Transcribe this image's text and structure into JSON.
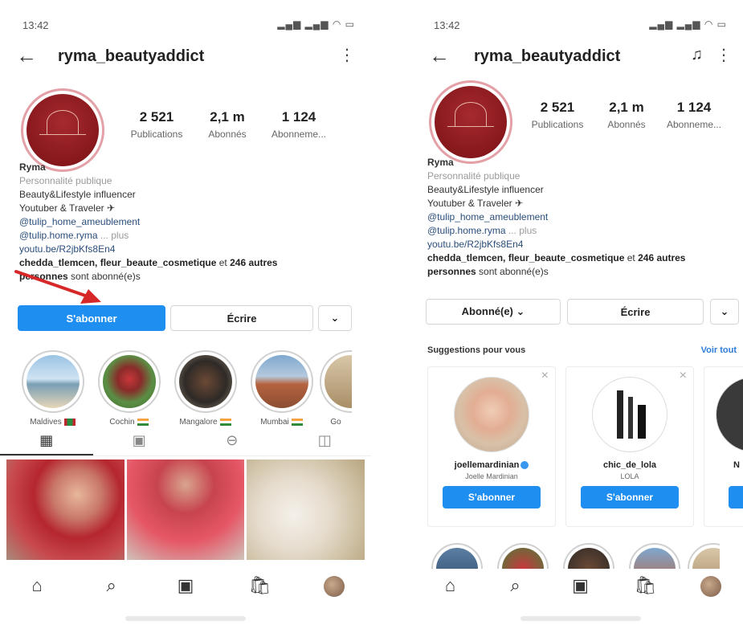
{
  "left": {
    "status_time": "13:42",
    "username": "ryma_beautyaddict",
    "stats": [
      {
        "num": "2 521",
        "label": "Publications"
      },
      {
        "num": "2,1 m",
        "label": "Abonnés"
      },
      {
        "num": "1 124",
        "label": "Abonneme..."
      }
    ],
    "bio": {
      "name": "Ryma",
      "category": "Personnalité publique",
      "line1": "Beauty&Lifestyle influencer",
      "line2": "Youtuber & Traveler",
      "link1": "@tulip_home_ameublement",
      "link2": "@tulip.home.ryma",
      "more": "... plus",
      "url": "youtu.be/R2jbKfs8En4",
      "followed_names": "chedda_tlemcen, fleur_beaute_cosmetique",
      "followed_mid": " et ",
      "followed_count": "246 autres",
      "followed_people": "personnes",
      "followed_end": " sont abonné(e)s"
    },
    "buttons": {
      "follow": "S'abonner",
      "message": "Écrire",
      "dropdown": "⌄"
    },
    "highlights": [
      {
        "label": "Maldives"
      },
      {
        "label": "Cochin"
      },
      {
        "label": "Mangalore"
      },
      {
        "label": "Mumbai"
      },
      {
        "label": "Go"
      }
    ]
  },
  "right": {
    "status_time": "13:42",
    "username": "ryma_beautyaddict",
    "stats": [
      {
        "num": "2 521",
        "label": "Publications"
      },
      {
        "num": "2,1 m",
        "label": "Abonnés"
      },
      {
        "num": "1 124",
        "label": "Abonneme..."
      }
    ],
    "bio": {
      "name": "Ryma",
      "category": "Personnalité publique",
      "line1": "Beauty&Lifestyle influencer",
      "line2": "Youtuber & Traveler",
      "link1": "@tulip_home_ameublement",
      "link2": "@tulip.home.ryma",
      "more": "... plus",
      "url": "youtu.be/R2jbKfs8En4",
      "followed_names": "chedda_tlemcen, fleur_beaute_cosmetique",
      "followed_mid": " et ",
      "followed_count": "246 autres",
      "followed_people": "personnes",
      "followed_end": " sont abonné(e)s"
    },
    "buttons": {
      "following": "Abonné(e) ⌄",
      "message": "Écrire",
      "dropdown": "⌄"
    },
    "suggestions_title": "Suggestions pour vous",
    "see_all": "Voir tout",
    "suggestions": [
      {
        "username": "joellemardinian",
        "name": "Joelle Mardinian",
        "button": "S'abonner"
      },
      {
        "username": "chic_de_lola",
        "name": "LOLA",
        "button": "S'abonner"
      },
      {
        "username": "N",
        "name": "",
        "button": ""
      }
    ]
  },
  "icons": {
    "back": "←",
    "more": "⋮",
    "bell": "🔔",
    "home": "⌂",
    "search": "⌕",
    "reels": "▣",
    "shop": "🛍",
    "close": "×"
  },
  "colors": {
    "primary": "#1f8ef1",
    "link": "#2a4e7c",
    "avatar": "#8b1a1f",
    "arrow": "#d62828"
  }
}
